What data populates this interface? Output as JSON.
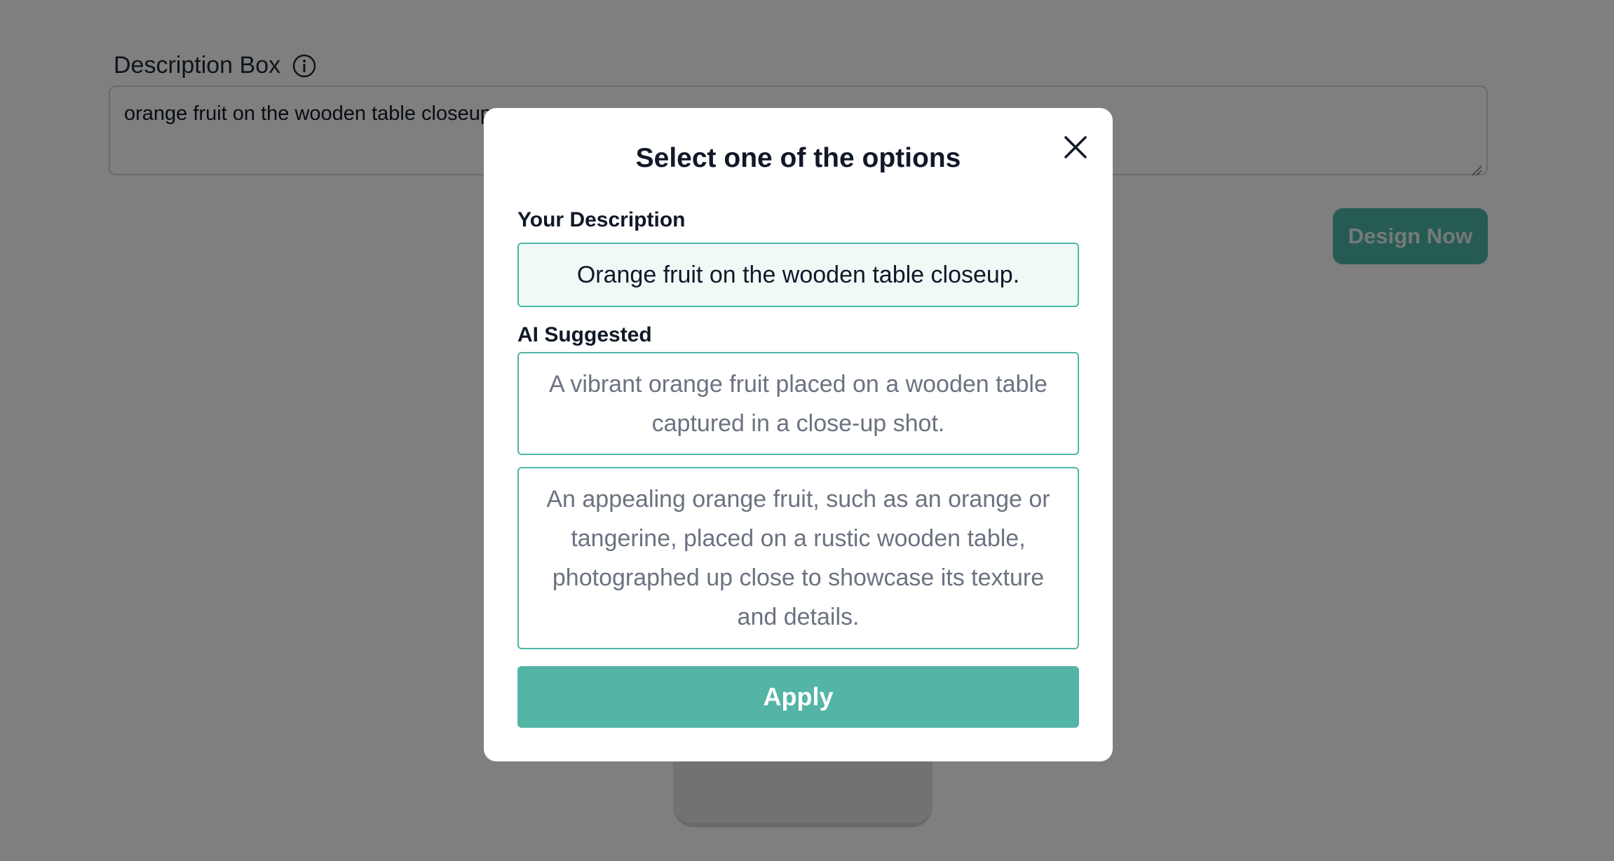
{
  "background": {
    "description_label": "Description Box",
    "description_value": "orange fruit on the wooden table closeup",
    "design_button_label": "Design Now"
  },
  "modal": {
    "title": "Select one of the options",
    "your_description_label": "Your Description",
    "your_description_value": "Orange fruit on the wooden table closeup.",
    "ai_suggested_label": "AI Suggested",
    "ai_options": [
      "A vibrant orange fruit placed on a wooden table captured in a close-up shot.",
      "An appealing orange fruit, such as an orange or tangerine, placed on a rustic wooden table, photographed up close to showcase its texture and details."
    ],
    "apply_label": "Apply"
  },
  "colors": {
    "accent": "#4db6a6",
    "selected_option_bg": "#effaf7",
    "overlay": "rgba(0,0,0,0.5)"
  },
  "icons": {
    "info": "info-icon",
    "close": "close-icon"
  }
}
